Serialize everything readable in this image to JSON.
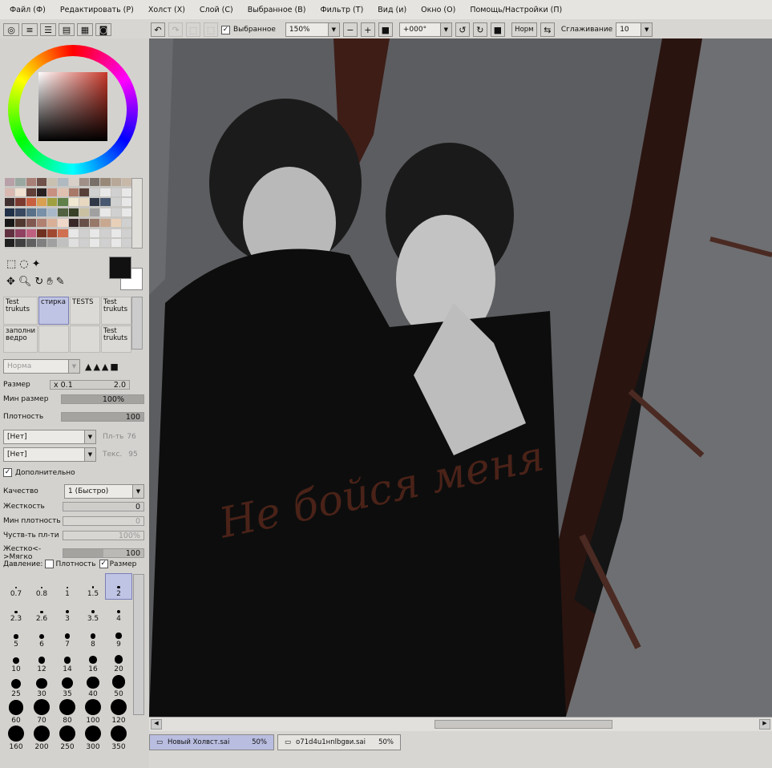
{
  "menu": [
    "Файл (Ф)",
    "Редактировать (Р)",
    "Холст (Х)",
    "Слой (С)",
    "Выбранное (В)",
    "Фильтр (Т)",
    "Вид (и)",
    "Окно (О)",
    "Помощь/Настройки (П)"
  ],
  "toolbar": {
    "selected_label": "Выбранное",
    "zoom": "150%",
    "angle": "+000°",
    "mode": "Норм",
    "smoothing_label": "Сглаживание",
    "smoothing_value": "10"
  },
  "brushes": [
    {
      "name": "Test trukuts"
    },
    {
      "name": "стирка"
    },
    {
      "name": "TESTS"
    },
    {
      "name": "Test trukuts"
    },
    {
      "name": "заполни ведро"
    },
    {
      "name": ""
    },
    {
      "name": ""
    },
    {
      "name": "Test trukuts"
    }
  ],
  "brush_mode": "Норма",
  "props": {
    "size_label": "Размер",
    "size_mult": "x 0.1",
    "size_value": "2.0",
    "min_size_label": "Мин размер",
    "min_size_value": "100%",
    "density_label": "Плотность",
    "density_value": "100",
    "none1": "[Нет]",
    "pl_label": "Пл-ть",
    "pl_value": "76",
    "none2": "[Нет]",
    "tex_label": "Текс.",
    "tex_value": "95",
    "extra_label": "Дополнительно",
    "quality_label": "Качество",
    "quality_value": "1 (Быстро)",
    "hardness_label": "Жесткость",
    "hardness_value": "0",
    "min_density_label": "Мин плотность",
    "min_density_value": "0",
    "sens_label": "Чуств-ть пл-ти",
    "sens_value": "100%",
    "soft_label": "Жестко<->Мягко",
    "soft_value": "100",
    "pressure_label": "Давление:",
    "pressure_density": "Плотность",
    "pressure_size": "Размер"
  },
  "sizes": [
    "0.7",
    "0.8",
    "1",
    "1.5",
    "2",
    "2.3",
    "2.6",
    "3",
    "3.5",
    "4",
    "5",
    "6",
    "7",
    "8",
    "9",
    "10",
    "12",
    "14",
    "16",
    "20",
    "25",
    "30",
    "35",
    "40",
    "50",
    "60",
    "70",
    "80",
    "100",
    "120",
    "160",
    "200",
    "250",
    "300",
    "350"
  ],
  "tabs": [
    {
      "name": "Новый Холвст.sai",
      "zoom": "50%"
    },
    {
      "name": "o71d4u1нnlbgви.sai",
      "zoom": "50%"
    }
  ],
  "canvas_text": "Не бойся меня"
}
